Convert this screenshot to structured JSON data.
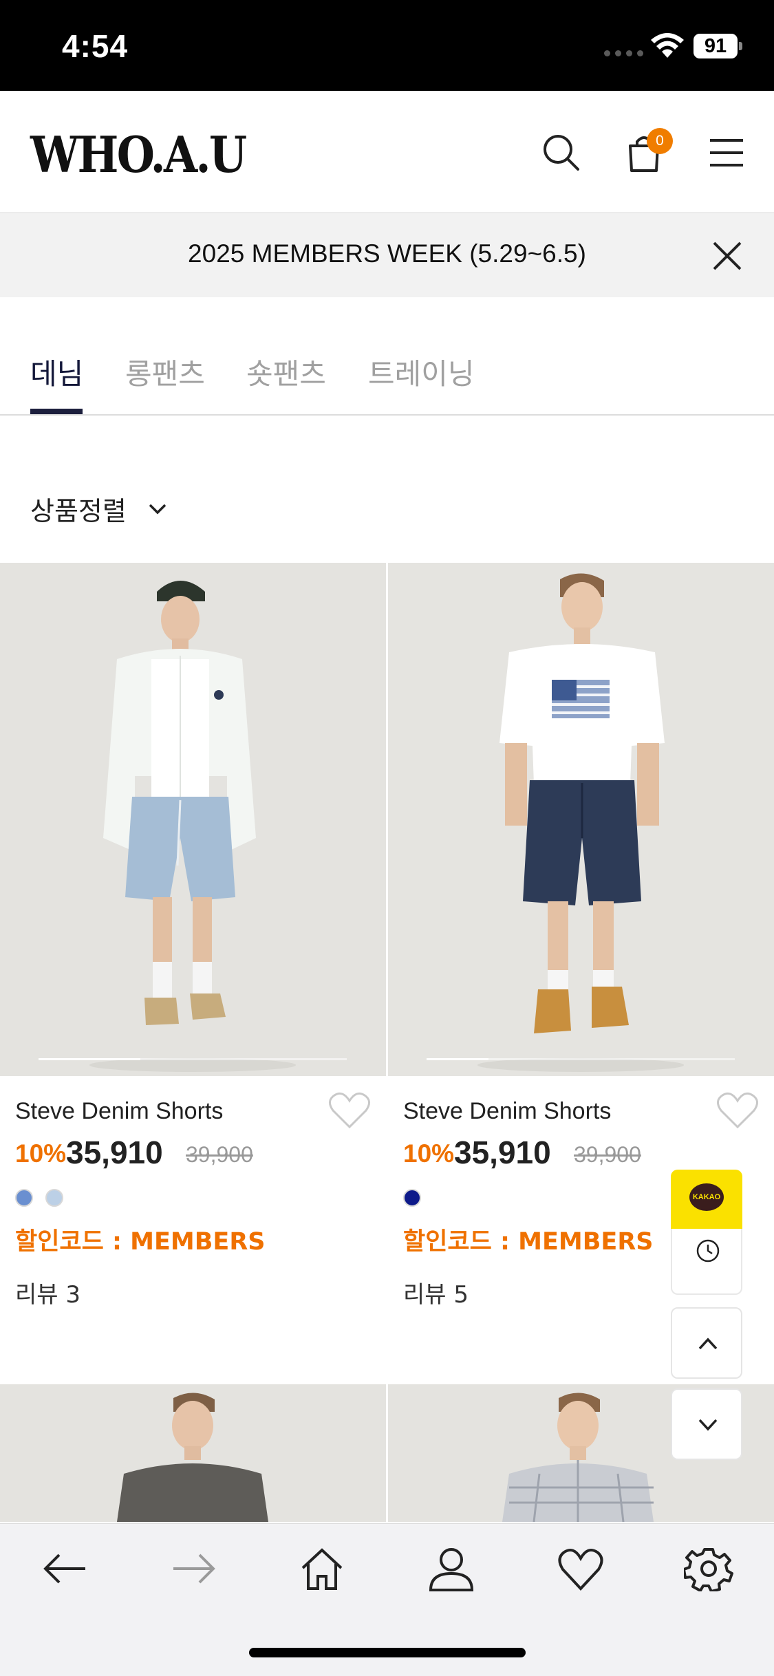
{
  "status_bar": {
    "time": "4:54",
    "battery": "91"
  },
  "header": {
    "logo": "WHO.A.U",
    "cart_count": "0"
  },
  "notice": {
    "text": "2025 MEMBERS WEEK (5.29~6.5)"
  },
  "tabs": [
    {
      "label": "데님",
      "active": true
    },
    {
      "label": "롱팬츠",
      "active": false
    },
    {
      "label": "숏팬츠",
      "active": false
    },
    {
      "label": "트레이닝",
      "active": false
    }
  ],
  "sort": {
    "label": "상품정렬"
  },
  "products": [
    {
      "name": "Steve Denim Shorts",
      "discount": "10%",
      "price": "35,910",
      "original_price": "39,900",
      "swatches": [
        "#6a8fd0",
        "#bcd0e6"
      ],
      "code": "할인코드 : MEMBERS",
      "reviews": "리뷰 3",
      "image_slide_progress": 0.33
    },
    {
      "name": "Steve Denim Shorts",
      "discount": "10%",
      "price": "35,910",
      "original_price": "39,900",
      "swatches": [
        "#0d1a8a"
      ],
      "code": "할인코드 : MEMBERS",
      "reviews": "리뷰 5",
      "image_slide_progress": 0.2
    }
  ],
  "floating": {
    "kakao_label": "KAKAO"
  },
  "colors": {
    "accent": "#ef7100",
    "tab_active": "#1c1f3d",
    "kakao": "#fae100"
  }
}
